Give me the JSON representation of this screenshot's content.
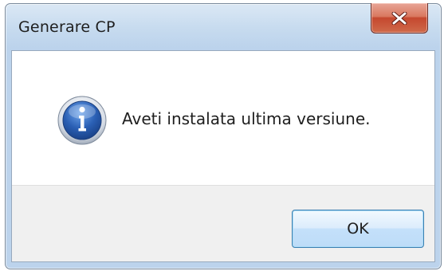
{
  "window": {
    "title": "Generare CP"
  },
  "dialog": {
    "icon": "info-icon",
    "message": "Aveti instalata ultima versiune.",
    "ok_label": "OK"
  },
  "colors": {
    "close_button": "#c5482f",
    "ok_border": "#3c7fb1",
    "info_icon": "#2a5fb4"
  }
}
